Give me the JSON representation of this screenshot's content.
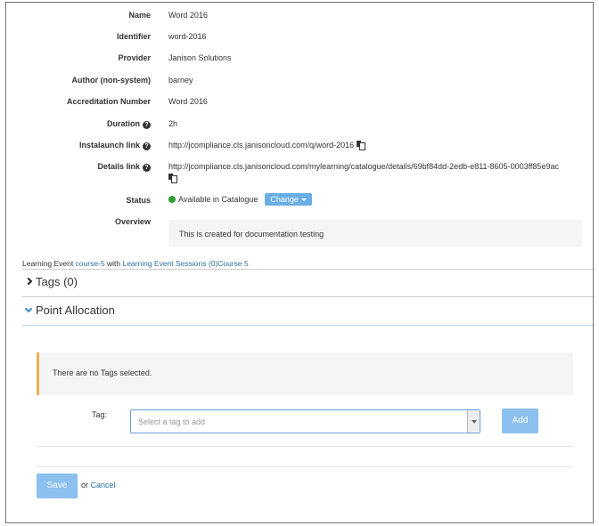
{
  "properties": [
    {
      "label": "Name",
      "value": "Word 2016"
    },
    {
      "label": "Identifier",
      "value": "word-2016"
    },
    {
      "label": "Provider",
      "value": "Janison Solutions"
    },
    {
      "label": "Author (non-system)",
      "value": "barney"
    },
    {
      "label": "Accreditation Number",
      "value": "Word 2016"
    },
    {
      "label": "Duration",
      "value": "2h"
    },
    {
      "label": "Instalaunch link",
      "value": "http://jcompliance.cls.janisoncloud.com/q/word-2016"
    },
    {
      "label": "Details link",
      "value": "http://jcompliance.cls.janisoncloud.com/mylearning/catalogue/details/69bf84dd-2edb-e811-8605-0003ff85e9ac"
    },
    {
      "label": "Status",
      "value": "Available in Catalogue"
    },
    {
      "label": "Overview",
      "value": "This is created for documentation testing"
    }
  ],
  "status": {
    "color": "#2f9b33",
    "change_label": "Change"
  },
  "learning_event": {
    "prefix": "Learning Event ",
    "course_link": "course-5",
    "middle": " with ",
    "sessions_link": "Learning Event Sessions (0)",
    "course_name_link": "Course 5"
  },
  "accordion": {
    "tags_title": "Tags (0)",
    "points_title": "Point Allocation"
  },
  "alert": {
    "message": "There are no Tags selected.",
    "accent": "#f0ad4e"
  },
  "tag_form": {
    "label": "Tag:",
    "placeholder": "Select a tag to add",
    "add_label": "Add"
  },
  "footer": {
    "save_label": "Save",
    "or_text": "or",
    "cancel_label": "Cancel"
  },
  "icons": {
    "help": "question-circle-icon",
    "copy": "clipboard-copy-icon",
    "status": "green-dot-icon",
    "collapsed": "chevron-right-icon",
    "expanded": "chevron-down-icon"
  }
}
